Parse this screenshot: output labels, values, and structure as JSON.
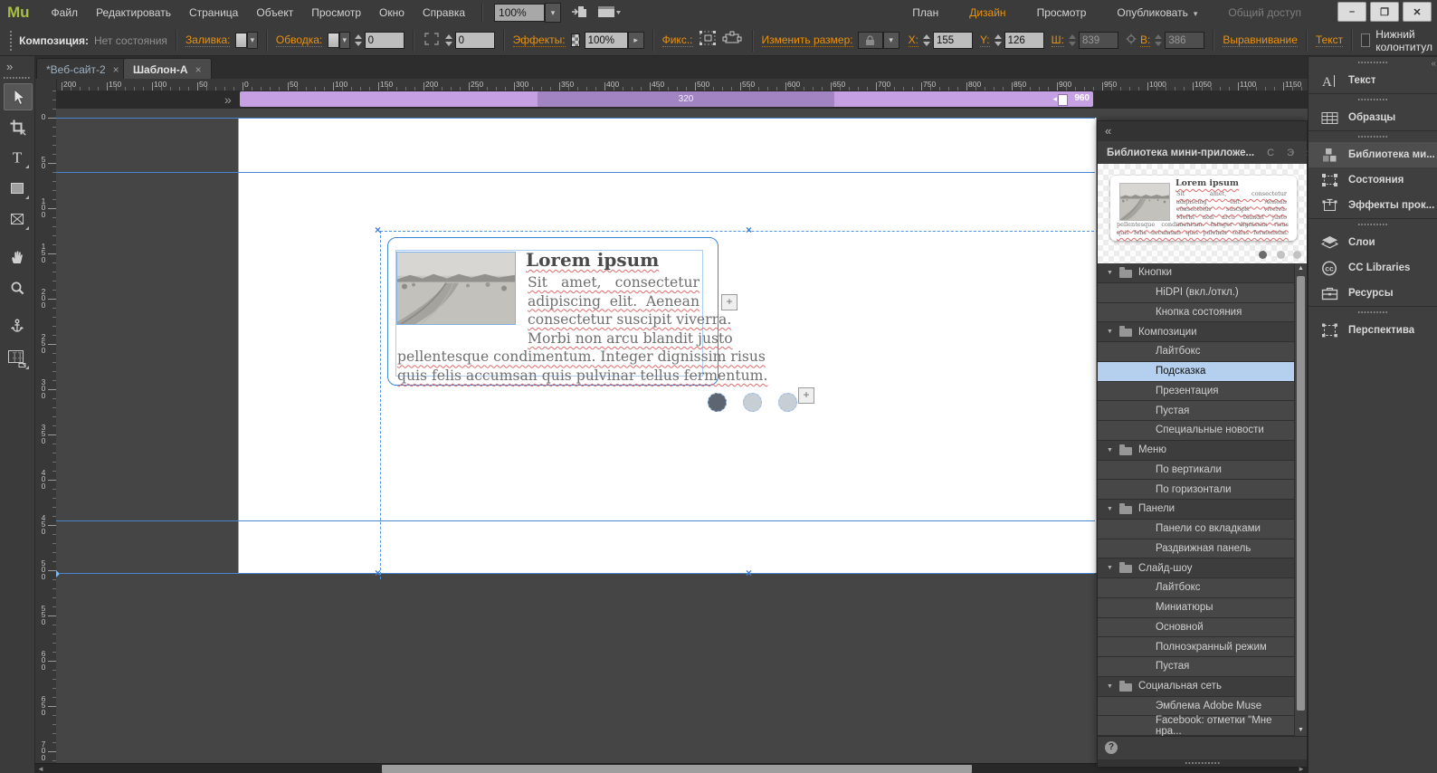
{
  "app": {
    "logo": "Mu",
    "window_controls": {
      "minimize": "–",
      "restore": "❐",
      "close": "✕"
    }
  },
  "menubar": {
    "items": [
      "Файл",
      "Редактировать",
      "Страница",
      "Объект",
      "Просмотр",
      "Окно",
      "Справка"
    ],
    "zoom_value": "100%",
    "modes": [
      {
        "label": "План"
      },
      {
        "label": "Дизайн",
        "active": true
      },
      {
        "label": "Просмотр"
      },
      {
        "label": "Опубликовать",
        "arrow": true
      },
      {
        "label": "Общий доступ",
        "disabled": true
      }
    ]
  },
  "controlbar": {
    "composition_label": "Композиция:",
    "composition_value": "Нет состояния",
    "fill_label": "Заливка:",
    "stroke_label": "Обводка:",
    "stroke_width": "0",
    "corner_radius": "0",
    "effects_label": "Эффекты:",
    "effects_value": "100%",
    "pin_label": "Фикс.:",
    "resize_label": "Изменить размер:",
    "x_label": "X:",
    "x_value": "155",
    "y_label": "Y:",
    "y_value": "126",
    "w_label": "Ш:",
    "w_value": "839",
    "h_label": "В:",
    "h_value": "386",
    "align_label": "Выравнивание",
    "text_label": "Текст",
    "footer_label": "Нижний колонтитул",
    "footer_checked": false
  },
  "tabs": [
    {
      "label": "*Веб-сайт-2"
    },
    {
      "label": "Шаблон-А",
      "active": true
    }
  ],
  "breakpoint": {
    "mid_value": "320",
    "handle_value": "960"
  },
  "rulers": {
    "horizontal": [
      "200",
      "150",
      "100",
      "50",
      "0",
      "50",
      "100",
      "150",
      "200",
      "250",
      "300",
      "350",
      "400",
      "450",
      "500",
      "550",
      "600",
      "650",
      "700",
      "750",
      "800",
      "850",
      "900",
      "950",
      "1000",
      "1050",
      "1100",
      "1150"
    ],
    "vertical": [
      "0",
      "50",
      "100",
      "150",
      "200",
      "250",
      "300",
      "350",
      "400",
      "450",
      "500",
      "550",
      "600",
      "650",
      "700"
    ]
  },
  "tools": [
    {
      "name": "selection-tool",
      "selected": true
    },
    {
      "name": "crop-tool"
    },
    {
      "name": "text-tool",
      "flyout": true
    },
    {
      "name": "rectangle-tool",
      "flyout": true
    },
    {
      "name": "frame-tool",
      "flyout": true
    },
    {
      "name": "hand-tool"
    },
    {
      "name": "zoom-tool"
    },
    {
      "name": "anchor-tool"
    },
    {
      "name": "text-sync-tool",
      "flyout": true
    }
  ],
  "widget": {
    "heading": "Lorem ipsum",
    "body_lines": [
      "Sit amet, consectetur",
      "adipiscing elit. Aenean",
      "consectetur suscipit viverra.",
      "Morbi non arcu blandit justo",
      "pellentesque condimentum. Integer dignissim risus",
      "quis felis accumsan quis pulvinar tellus fermentum."
    ]
  },
  "library": {
    "title": "Библиотека мини-приложе...",
    "hidden_tabs": [
      "С",
      "Э"
    ],
    "selected_group": 1,
    "selected_index": 1,
    "groups": [
      {
        "label": "Кнопки",
        "items": [
          "HiDPI (вкл./откл.)",
          "Кнопка состояния"
        ]
      },
      {
        "label": "Композиции",
        "items": [
          "Лайтбокс",
          "Подсказка",
          "Презентация",
          "Пустая",
          "Специальные новости"
        ]
      },
      {
        "label": "Меню",
        "items": [
          "По вертикали",
          "По горизонтали"
        ]
      },
      {
        "label": "Панели",
        "items": [
          "Панели со вкладками",
          "Раздвижная панель"
        ]
      },
      {
        "label": "Слайд-шоу",
        "items": [
          "Лайтбокс",
          "Миниатюры",
          "Основной",
          "Полноэкранный режим",
          "Пустая"
        ]
      },
      {
        "label": "Социальная сеть",
        "items": [
          "Эмблема Adobe Muse",
          "Facebook: отметки \"Мне нра..."
        ]
      }
    ]
  },
  "dock": {
    "items": [
      {
        "label": "Текст",
        "icon": "text",
        "sep": true
      },
      {
        "label": "Образцы",
        "icon": "swatches",
        "sep": true
      },
      {
        "label": "Библиотека ми...",
        "icon": "library",
        "sep": true,
        "active": true
      },
      {
        "label": "Состояния",
        "icon": "states"
      },
      {
        "label": "Эффекты прок...",
        "icon": "scroll-effects"
      },
      {
        "label": "Слои",
        "icon": "layers",
        "sep": true
      },
      {
        "label": "CC Libraries",
        "icon": "cc-libraries"
      },
      {
        "label": "Ресурсы",
        "icon": "assets"
      },
      {
        "label": "Перспектива",
        "icon": "perspective",
        "sep": true
      }
    ]
  },
  "icons": {
    "collapse_right": "»",
    "collapse_left": "«",
    "tab_close": "×",
    "dropdown": "▾",
    "submenu": "▸",
    "help": "?",
    "plus": "+",
    "scroll_left": "◄",
    "scroll_right": "►",
    "scroll_up": "▲",
    "scroll_down": "▼",
    "bp_left": "◂"
  },
  "colors": {
    "accent_orange": "#e8920f",
    "selection_blue": "#4a90d9",
    "breakpoint_purple": "#c5a0e3",
    "selected_row_blue": "#b5cfee"
  }
}
